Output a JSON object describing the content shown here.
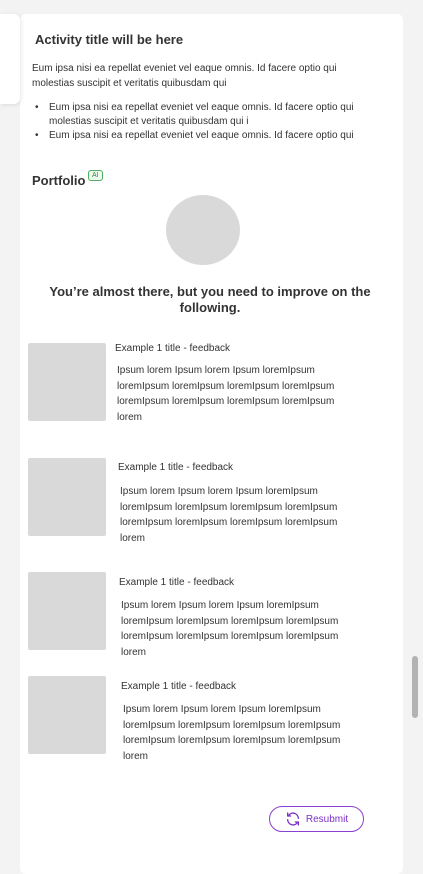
{
  "activity": {
    "title": "Activity title will be here",
    "description": "Eum ipsa nisi ea repellat eveniet vel eaque omnis. Id facere optio qui molestias suscipit et veritatis quibusdam qui",
    "bullets": [
      "Eum ipsa nisi ea repellat eveniet vel eaque omnis. Id facere optio qui molestias suscipit et veritatis quibusdam qui i",
      "Eum ipsa nisi ea repellat eveniet vel eaque omnis. Id facere optio qui"
    ]
  },
  "portfolio": {
    "title": "Portfolio",
    "badge": "AI",
    "headline": "You’re almost there, but you need to improve on the following.",
    "feedback": [
      {
        "title": "Example 1 title - feedback",
        "body": "Ipsum lorem Ipsum lorem Ipsum loremIpsum loremIpsum loremIpsum loremIpsum loremIpsum loremIpsum loremIpsum loremIpsum loremIpsum lorem"
      },
      {
        "title": "Example 1 title - feedback",
        "body": "Ipsum lorem Ipsum lorem Ipsum loremIpsum loremIpsum loremIpsum loremIpsum loremIpsum loremIpsum loremIpsum loremIpsum loremIpsum lorem"
      },
      {
        "title": "Example 1 title - feedback",
        "body": "Ipsum lorem Ipsum lorem Ipsum loremIpsum loremIpsum loremIpsum loremIpsum loremIpsum loremIpsum loremIpsum loremIpsum loremIpsum lorem"
      },
      {
        "title": "Example 1 title - feedback",
        "body": "Ipsum lorem Ipsum lorem Ipsum loremIpsum loremIpsum loremIpsum loremIpsum loremIpsum loremIpsum loremIpsum loremIpsum loremIpsum lorem"
      }
    ]
  },
  "actions": {
    "resubmit_label": "Resubmit",
    "resubmit_icon": "refresh-icon"
  },
  "colors": {
    "accent": "#7c2fc7",
    "badge": "#2e8b3e",
    "placeholder": "#d9d9d9"
  }
}
